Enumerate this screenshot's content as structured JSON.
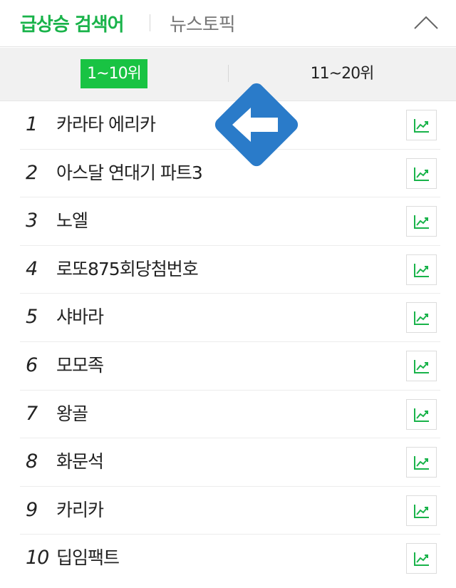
{
  "header": {
    "tab_realtime": "급상승 검색어",
    "tab_news": "뉴스토픽",
    "collapse_icon": "chevron-up-icon"
  },
  "range": {
    "active_label": "1~10위",
    "other_label": "11~20위"
  },
  "keywords": [
    {
      "rank": "1",
      "label": "카라타 에리카"
    },
    {
      "rank": "2",
      "label": "아스달 연대기 파트3"
    },
    {
      "rank": "3",
      "label": "노엘"
    },
    {
      "rank": "4",
      "label": "로또875회당첨번호"
    },
    {
      "rank": "5",
      "label": "샤바라"
    },
    {
      "rank": "6",
      "label": "모모족"
    },
    {
      "rank": "7",
      "label": "왕골"
    },
    {
      "rank": "8",
      "label": "화문석"
    },
    {
      "rank": "9",
      "label": "카리카"
    },
    {
      "rank": "10",
      "label": "딥임팩트"
    }
  ],
  "trend_icon": "trend-chart-icon",
  "overlay_icon": "left-arrow-diamond-icon",
  "colors": {
    "accent": "#19b34a",
    "active_bg": "#19c343",
    "overlay_blue": "#2a7bc9"
  }
}
